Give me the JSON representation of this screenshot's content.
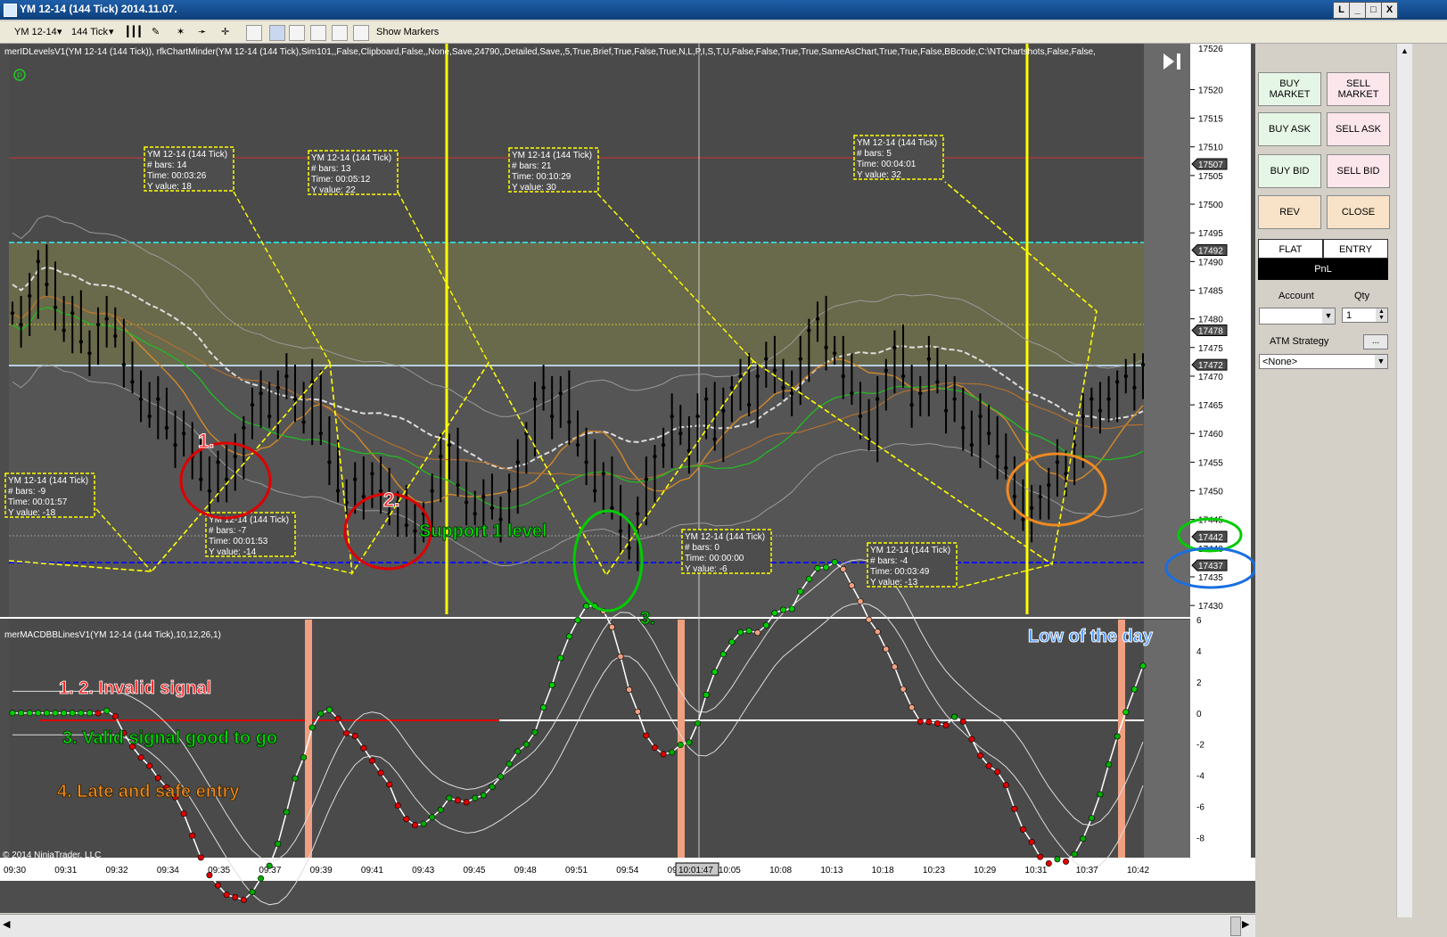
{
  "window": {
    "title": "YM 12-14 (144 Tick)  2014.11.07.",
    "buttons": [
      "L",
      "_",
      "□",
      "X"
    ]
  },
  "toolbar": {
    "instrument": "YM 12-14",
    "interval": "144 Tick",
    "show_markers": "Show Markers"
  },
  "indicator_header": "merIDLevelsV1(YM 12-14 (144 Tick)), rfkChartMinder(YM 12-14 (144 Tick),Sim101,,False,Clipboard,False,,None,Save,24790,,Detailed,Save,,5,True,Brief,True,False,True,N,L,P,I,S,T,U,False,False,True,True,SameAsChart,True,True,False,BBcode,C:\\NTChartshots,False,False,",
  "macd_header": "merMACDBBLinesV1(YM 12-14 (144 Tick),10,12,26,1)",
  "copyright": "© 2014 NinjaTrader, LLC",
  "price_axis": {
    "ticks": [
      17520,
      17515,
      17510,
      17505,
      17500,
      17495,
      17490,
      17485,
      17480,
      17475,
      17470,
      17465,
      17460,
      17455,
      17450,
      17445,
      17440,
      17435,
      17430
    ],
    "top_label": "17526",
    "markers": [
      {
        "value": "17507",
        "price": 17507
      },
      {
        "value": "17492",
        "price": 17492
      },
      {
        "value": "17478",
        "price": 17478
      },
      {
        "value": "17472",
        "price": 17472
      },
      {
        "value": "17442",
        "price": 17442
      },
      {
        "value": "17437",
        "price": 17437
      }
    ]
  },
  "macd_axis": {
    "ticks": [
      "6",
      "4",
      "2",
      "0",
      "-2",
      "-4",
      "-6",
      "-8"
    ]
  },
  "time_axis": {
    "labels": [
      "09:30",
      "09:31",
      "09:32",
      "09:34",
      "09:35",
      "09:37",
      "09:39",
      "09:41",
      "09:43",
      "09:45",
      "09:48",
      "09:51",
      "09:54",
      "09:57",
      "10:05",
      "10:08",
      "10:13",
      "10:18",
      "10:23",
      "10:29",
      "10:31",
      "10:37",
      "10:42"
    ],
    "cursor_time": "10:01:47"
  },
  "info_boxes": [
    {
      "title": "YM 12-14 (144 Tick)",
      "bars": "# bars:   14",
      "time": "Time:     00:03:26",
      "yval": "Y value: 18"
    },
    {
      "title": "YM 12-14 (144 Tick)",
      "bars": "# bars:   13",
      "time": "Time:     00:05:12",
      "yval": "Y value: 22"
    },
    {
      "title": "YM 12-14 (144 Tick)",
      "bars": "# bars:   21",
      "time": "Time:     00:10:29",
      "yval": "Y value: 30"
    },
    {
      "title": "YM 12-14 (144 Tick)",
      "bars": "# bars:   5",
      "time": "Time:     00:04:01",
      "yval": "Y value: 32"
    },
    {
      "title": "YM 12-14 (144 Tick)",
      "bars": "# bars:   -9",
      "time": "Time:     00:01:57",
      "yval": "Y value: -18"
    },
    {
      "title": "YM 12-14 (144 Tick)",
      "bars": "# bars:   -7",
      "time": "Time:     00:01:53",
      "yval": "Y value: -14"
    },
    {
      "title": "YM 12-14 (144 Tick)",
      "bars": "# bars:   0",
      "time": "Time:     00:00:00",
      "yval": "Y value: -6"
    },
    {
      "title": "YM 12-14 (144 Tick)",
      "bars": "# bars:   -4",
      "time": "Time:     00:03:49",
      "yval": "Y value: -13"
    }
  ],
  "annotations": {
    "n1": "1.",
    "n2": "2.",
    "n3": "3.",
    "support": "Support 1 level",
    "low_day": "Low of the day",
    "invalid": "1. 2. Invalid signal",
    "valid": "3. Valid signal good to go",
    "late": "4. Late and safe entry"
  },
  "order_panel": {
    "buy_market": "BUY MARKET",
    "sell_market": "SELL MARKET",
    "buy_ask": "BUY ASK",
    "sell_ask": "SELL ASK",
    "buy_bid": "BUY BID",
    "sell_bid": "SELL BID",
    "rev": "REV",
    "close": "CLOSE",
    "flat": "FLAT",
    "entry": "ENTRY",
    "pnl": "PnL",
    "account_label": "Account",
    "qty_label": "Qty",
    "qty_value": "1",
    "atm_label": "ATM Strategy",
    "atm_btn": "...",
    "atm_value": "<None>"
  },
  "colors": {
    "yellow": "#ffff00",
    "cyan": "#33cccc",
    "blue_level": "#1010ff",
    "up_green": "#00cc00",
    "down_red": "#dd0000",
    "salmon": "#f0a080"
  },
  "chart_data": {
    "type": "candlestick",
    "price_range": [
      17428,
      17528
    ],
    "macd_range": [
      -9,
      6
    ],
    "price_closes": [
      17481,
      17479,
      17484,
      17490,
      17486,
      17482,
      17478,
      17481,
      17476,
      17474,
      17479,
      17480,
      17477,
      17472,
      17469,
      17466,
      17463,
      17466,
      17461,
      17458,
      17460,
      17456,
      17452,
      17450,
      17455,
      17452,
      17456,
      17461,
      17465,
      17467,
      17463,
      17468,
      17470,
      17466,
      17462,
      17469,
      17460,
      17455,
      17450,
      17448,
      17452,
      17449,
      17453,
      17450,
      17446,
      17448,
      17444,
      17443,
      17446,
      17450,
      17456,
      17458,
      17451,
      17448,
      17446,
      17449,
      17447,
      17445,
      17450,
      17455,
      17460,
      17466,
      17468,
      17463,
      17467,
      17462,
      17458,
      17455,
      17450,
      17453,
      17447,
      17443,
      17440,
      17446,
      17452,
      17456,
      17458,
      17463,
      17460,
      17457,
      17463,
      17466,
      17459,
      17464,
      17468,
      17470,
      17465,
      17470,
      17473,
      17471,
      17468,
      17467,
      17473,
      17478,
      17480,
      17475,
      17474,
      17470,
      17467,
      17463,
      17459,
      17466,
      17471,
      17475,
      17470,
      17465,
      17467,
      17473,
      17469,
      17464,
      17466,
      17461,
      17458,
      17463,
      17460,
      17456,
      17454,
      17449,
      17445,
      17447,
      17449,
      17451,
      17455,
      17453,
      17458,
      17463,
      17466,
      17464,
      17466,
      17469,
      17470,
      17468,
      17472
    ]
  }
}
